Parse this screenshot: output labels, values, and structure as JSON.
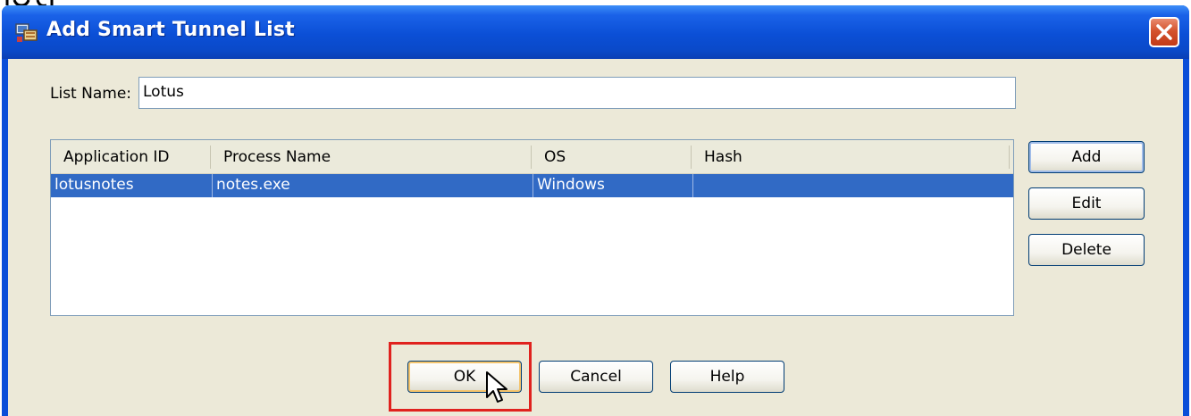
{
  "window": {
    "title": "Add Smart Tunnel List",
    "title_icon": "network-list-icon",
    "close_icon": "close-x-icon"
  },
  "form": {
    "list_name_label": "List Name:",
    "list_name_value": "Lotus"
  },
  "table": {
    "columns": [
      "Application ID",
      "Process Name",
      "OS",
      "Hash"
    ],
    "rows": [
      {
        "application_id": "lotusnotes",
        "process_name": "notes.exe",
        "os": "Windows",
        "hash": "",
        "selected": true
      }
    ]
  },
  "side_buttons": {
    "add": "Add",
    "edit": "Edit",
    "delete": "Delete"
  },
  "bottom_buttons": {
    "ok": "OK",
    "cancel": "Cancel",
    "help": "Help"
  },
  "colors": {
    "titlebar": "#0b4fd6",
    "client_bg": "#ece9d8",
    "selection": "#316ac5",
    "highlight_box": "#e0221e",
    "close_button": "#d4532e"
  }
}
